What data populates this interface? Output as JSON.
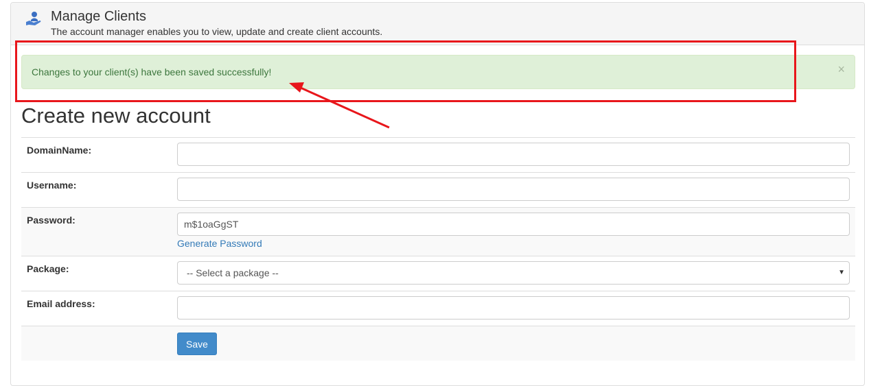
{
  "header": {
    "title": "Manage Clients",
    "subtitle": "The account manager enables you to view, update and create client accounts.",
    "icon": "user-hand-icon"
  },
  "alert": {
    "message": "Changes to your client(s) have been saved successfully!",
    "close_label": "×",
    "color": "#3c763d",
    "background": "#dff0d8"
  },
  "annotation": {
    "color": "#e8161b"
  },
  "form": {
    "title": "Create new account",
    "fields": {
      "domain": {
        "label": "DomainName:",
        "value": ""
      },
      "username": {
        "label": "Username:",
        "value": ""
      },
      "password": {
        "label": "Password:",
        "value": "m$1oaGgST",
        "generate_link": "Generate Password"
      },
      "package": {
        "label": "Package:",
        "selected": "-- Select a package --"
      },
      "email": {
        "label": "Email address:",
        "value": ""
      }
    },
    "save_label": "Save"
  }
}
